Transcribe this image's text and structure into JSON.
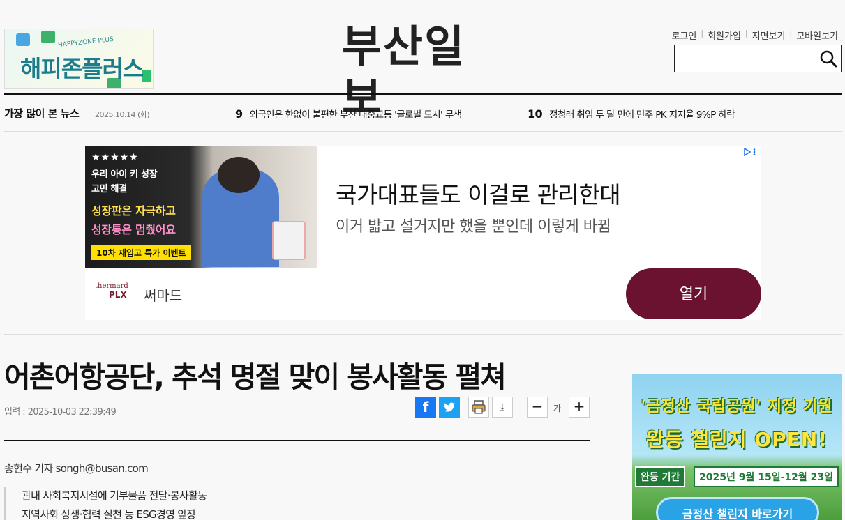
{
  "header": {
    "promo_banner": {
      "sub": "HAPPYZONE PLUS",
      "main": "해피존플러스"
    },
    "masthead": "부산일보",
    "util_links": [
      "로그인",
      "회원가입",
      "지면보기",
      "모바일보기"
    ],
    "search": {
      "placeholder": "",
      "icon": "search-icon"
    }
  },
  "ticker": {
    "label": "가장 많이 본 뉴스",
    "date": "2025.10.14 (화)",
    "items": [
      {
        "num": "9",
        "title": "외국인은 한없이 불편한 부산 대중교통 '글로벌 도시' 무색"
      },
      {
        "num": "10",
        "title": "정청래 취임 두 달 만에 민주 PK 지지율 9%P 하락"
      }
    ]
  },
  "ad": {
    "stars": "★★★★★",
    "line1": "우리 아이 키 성장",
    "line2": "고민 해결",
    "line3": "성장판은 자극하고",
    "line4": "성장통은 멈췄어요",
    "tag": "10차 재입고 특가 이벤트",
    "title": "국가대표들도 이걸로 관리한대",
    "desc": "이거 밟고 설거지만 했을 뿐인데 이렇게 바뀜",
    "brand_logo_top": "thermard",
    "brand_logo_bottom": "PLX",
    "brand": "써마드",
    "open": "열기",
    "choice_icon": "ad-choices-icon"
  },
  "article": {
    "headline": "어촌어항공단, 추석 명절 맞이 봉사활동 펼쳐",
    "meta": "입력 : 2025-10-03 22:39:49",
    "tools": {
      "facebook": "f",
      "download": "⤓",
      "zoom_out": "−",
      "font_label": "가",
      "zoom_in": "+"
    },
    "byline": "송현수 기자 songh@busan.com",
    "summary": [
      "관내 사회복지시설에 기부물품 전달·봉사활동",
      "지역사회 상생·협력 실천 등 ESG경영 앞장"
    ]
  },
  "side_ad": {
    "headline1": "'금정산 국립공원' 지정 기원",
    "headline2": "완등 챌린지 OPEN!",
    "period_label": "완등 기간",
    "period": "2025년 9월 15일-12월 23일",
    "cta": "금정산 챌린지 바로가기"
  }
}
